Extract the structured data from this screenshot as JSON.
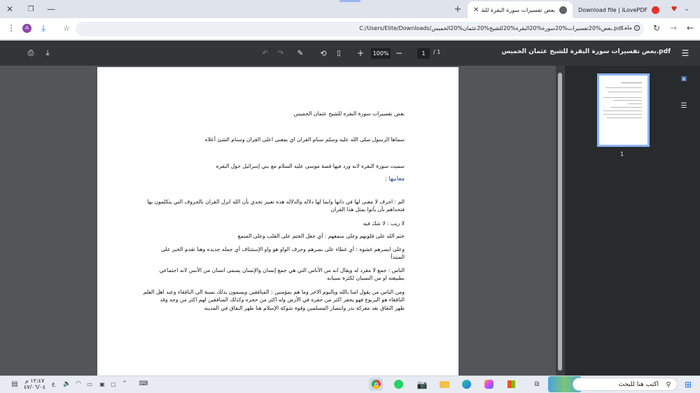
{
  "browser": {
    "tabs": [
      {
        "title": "بعض تفسيرات سورة البقرة للشيخ",
        "active": true
      },
      {
        "title": "Download file | iLovePDF",
        "active": false
      }
    ],
    "new_tab": "+",
    "address": "C:/Users/Elite/Downloads/بعض%20تفسيرات%20سورة%20البقرة%20للشيخ%20عثمان%20الخميس.pdf",
    "address_chip": "ملف",
    "profile_initial": "A"
  },
  "pdf_toolbar": {
    "title": "بعض تفسيرات سورة البقرة للشيخ عثمان الخميس.pdf",
    "zoom": "100%",
    "page_current": "1",
    "page_total": "/ 1",
    "zoom_in": "+",
    "zoom_out": "−"
  },
  "document": {
    "lines": [
      "بعض تفسيرات سورة البقره للشيخ عثمان الخميس",
      "سماها الرسول صلى الله عليه وسلم سنام القران اي بمعنى اعلى القران وسنام الشئ أعلاه",
      "سميت سورة البقره لانه ورد فيها قصة موسى عليه السلام مع بني إسرائيل حول البقره",
      "معانيها :",
      "الم : احرف لا معنى لها في ذاتها وانما لها دلاله والدلاله هذه تعبير تحدي بأن الله انزل القران بالحروف التي يتكلمون بها",
      "فتحداهم بأن يأتوا بمثل هذا القران",
      "لا ريب : لا شك فيه",
      "ختم الله على قلوبهم وعلى سمعهم : أي جعل الختم على القلب وعلى السمع",
      "وعلى ابصرهم غشوه : أي غطاء على بصرهم وحرف الواو هو واو الإستئناف أي جمله جديده وهنا تقدم الخبر على",
      "المبتدأ",
      "الناس : جمع لا مفرد له ويقال انه من الأناس التي هي جمع إنسان والإنسان يسمى انسان من الأنس لانه اجتماعي",
      "بطبيعته او من النسيان لكثرة نسيانه",
      "ومن الناس من يقول امنا بالله وباليوم الاخر وما هم بمؤمنين : المنافقين ويسمون بذلك نسبة الى النافقاء وعند اهل العلم",
      "النافقاء هو اليربوع فهو يحفر اكثر من حفره في الأرض وله اكثر من حجره وكذلك المنافقين لهم اكثر من وجه وقد",
      "ظهر النفاق بعد معركة بدر وانتصار المسلمين وقوة شوكة الإسلام هنا ظهر النفاق في المدينه"
    ]
  },
  "sidebar": {
    "thumbnail_page": "1"
  },
  "taskbar": {
    "search_placeholder": "اكتب هنا للبحث",
    "time": "١٢:٤٧ م",
    "date": "٤٧/٠٦/٠٤",
    "lang": "ع"
  }
}
